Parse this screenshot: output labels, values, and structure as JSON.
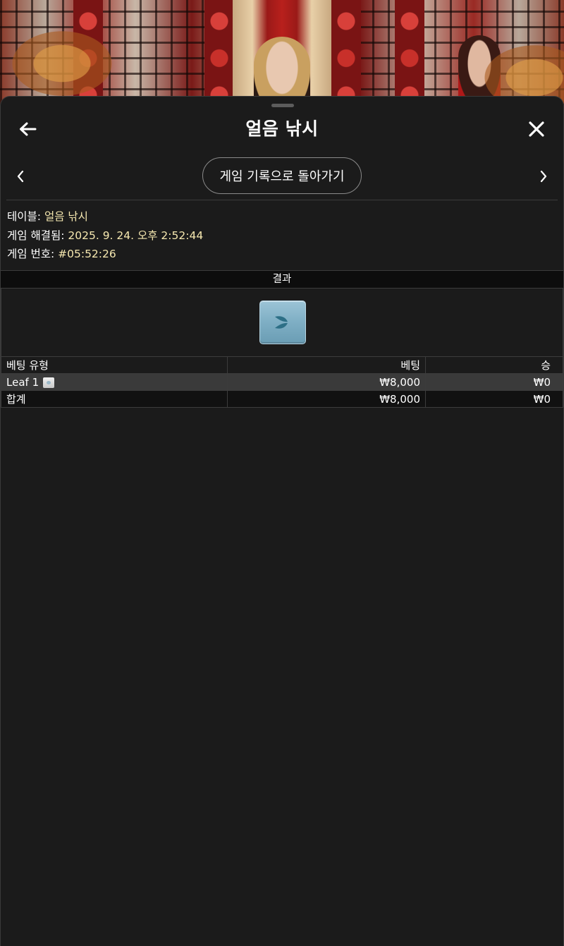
{
  "header": {
    "title": "얼음 낚시"
  },
  "nav": {
    "history_button": "게임 기록으로 돌아가기"
  },
  "info": {
    "table_label": "테이블:",
    "table_value": "얼음 낚시",
    "resolved_label": "게임 해결됨:",
    "resolved_value": "2025. 9. 24. 오후 2:52:44",
    "game_no_label": "게임 번호:",
    "game_no_value": "#05:52:26"
  },
  "result": {
    "header": "결과",
    "tile_icon": "leaf-icon"
  },
  "bets_table": {
    "columns": [
      "베팅 유형",
      "베팅",
      "승"
    ],
    "rows": [
      {
        "type": "Leaf 1",
        "bet": "₩8,000",
        "win": "₩0"
      }
    ],
    "total": {
      "type": "합계",
      "bet": "₩8,000",
      "win": "₩0"
    }
  },
  "colors": {
    "sheet_bg": "#1b1b1b",
    "value_text": "#f6e8b0",
    "tile": "#7eaec4"
  }
}
